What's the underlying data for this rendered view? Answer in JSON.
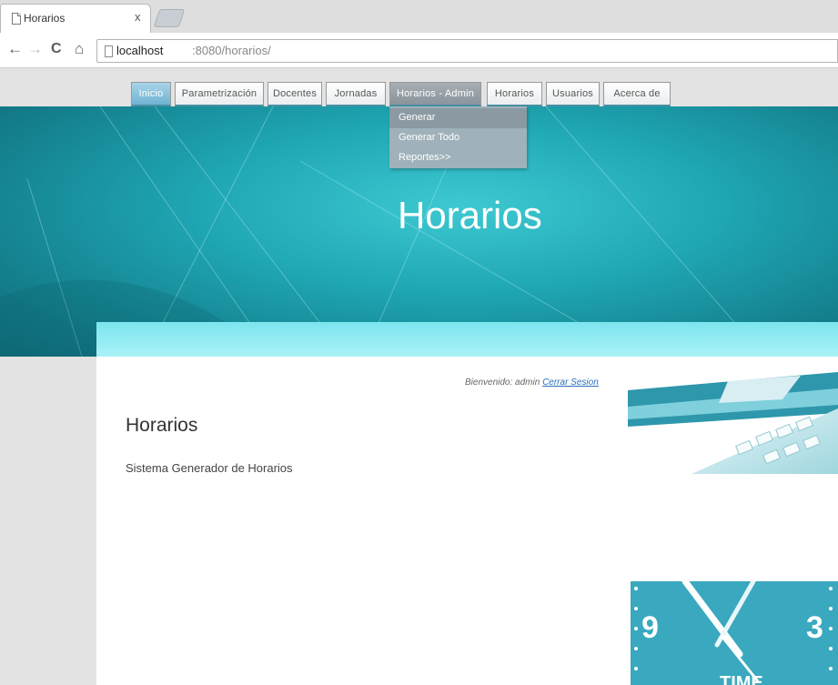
{
  "browser": {
    "tab_title": "Horarios",
    "tab_close": "x",
    "url_host": "localhost",
    "url_path": ":8080/horarios/"
  },
  "nav_icons": {
    "back": "←",
    "forward": "→",
    "reload": "C",
    "home": "⌂"
  },
  "menu": {
    "items": [
      {
        "label": "Inicio"
      },
      {
        "label": "Parametrización"
      },
      {
        "label": "Docentes"
      },
      {
        "label": "Jornadas"
      },
      {
        "label": "Horarios - Admin"
      },
      {
        "label": "Horarios"
      },
      {
        "label": "Usuarios"
      },
      {
        "label": "Acerca de"
      }
    ],
    "dropdown": [
      {
        "label": "Generar"
      },
      {
        "label": "Generar Todo"
      },
      {
        "label": "Reportes>>"
      }
    ]
  },
  "banner": {
    "title": "Horarios"
  },
  "content": {
    "welcome_text": "Bienvenido: admin",
    "logout_link": "Cerrar Sesion",
    "heading": "Horarios",
    "subtitle": "Sistema Generador de Horarios"
  },
  "clock_image": {
    "numbers": [
      "9",
      "3"
    ],
    "word": "TIME"
  },
  "colors": {
    "banner_teal": "#1fa7b3",
    "band_light": "#a9f2f7",
    "link_blue": "#2a6ebb"
  }
}
